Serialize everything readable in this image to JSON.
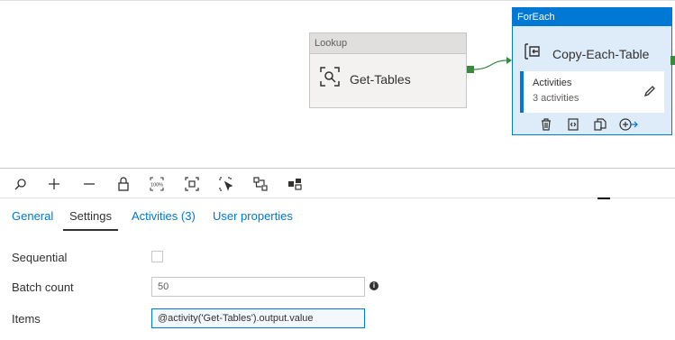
{
  "lookup": {
    "header": "Lookup",
    "name": "Get-Tables"
  },
  "foreach": {
    "header": "ForEach",
    "name": "Copy-Each-Table",
    "activities_label": "Activities",
    "activities_count": "3 activities"
  },
  "toolbar": {
    "icons": [
      "search-icon",
      "zoom-in-icon",
      "zoom-out-icon",
      "lock-icon",
      "zoom-100-icon",
      "fit-to-window-icon",
      "select-icon",
      "auto-align-icon",
      "layout-icon"
    ]
  },
  "tabs": [
    {
      "label": "General"
    },
    {
      "label": "Settings"
    },
    {
      "label": "Activities (3)"
    },
    {
      "label": "User properties"
    }
  ],
  "settings": {
    "sequential_label": "Sequential",
    "batch_count_label": "Batch count",
    "batch_count_placeholder": "50",
    "items_label": "Items",
    "items_value": "@activity('Get-Tables').output.value"
  },
  "colors": {
    "accent": "#0078d4",
    "port": "#3a8a3e"
  }
}
